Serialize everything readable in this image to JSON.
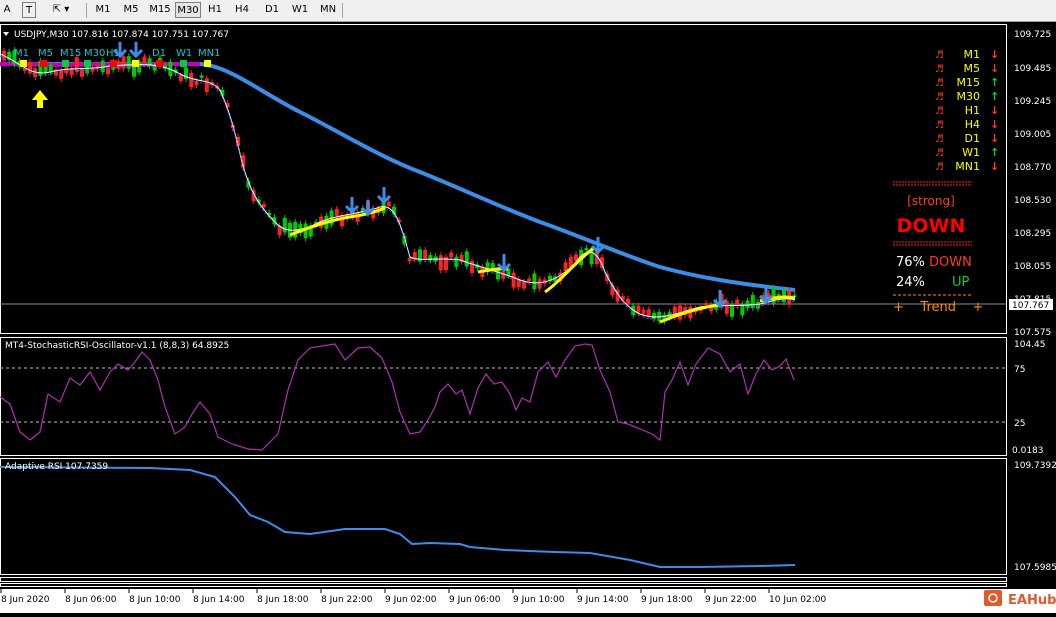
{
  "toolbar": {
    "tools": [
      "A",
      "T"
    ],
    "timeframes": [
      "M1",
      "M5",
      "M15",
      "M30",
      "H1",
      "H4",
      "D1",
      "W1",
      "MN"
    ],
    "active_timeframe": "M30"
  },
  "main_chart": {
    "header": "USDJPY,M30  107.816 107.874 107.751 107.767",
    "tf_strip": [
      "M1",
      "M5",
      "M15",
      "M30",
      "H1",
      "D1",
      "W1",
      "MN1"
    ],
    "price_axis": [
      "109.725",
      "109.485",
      "109.245",
      "109.005",
      "108.770",
      "108.530",
      "108.295",
      "108.055",
      "107.815",
      "107.575"
    ],
    "current_price": "107.767"
  },
  "signal_panel": {
    "rows": [
      {
        "tf": "M1",
        "dir": "down"
      },
      {
        "tf": "M5",
        "dir": "down"
      },
      {
        "tf": "M15",
        "dir": "up"
      },
      {
        "tf": "M30",
        "dir": "up"
      },
      {
        "tf": "H1",
        "dir": "down"
      },
      {
        "tf": "H4",
        "dir": "down"
      },
      {
        "tf": "D1",
        "dir": "down"
      },
      {
        "tf": "W1",
        "dir": "up"
      },
      {
        "tf": "MN1",
        "dir": "down"
      }
    ],
    "strength": "[strong]",
    "verdict": "DOWN",
    "down_pct": "76%",
    "down_label": "DOWN",
    "up_pct": "24%",
    "up_label": "UP",
    "trend_label": "+    Trend    +",
    "colors": {
      "up": "#00cc44",
      "down": "#ff3b1f",
      "label": "#ffff00",
      "verdict": "#ff0000",
      "trend": "#ff8a00"
    }
  },
  "stoch_panel": {
    "title": "MT4-StochasticRSI-Oscillator-v1.1 (8,8,3) 64.8925",
    "axis": [
      "104.45",
      "75",
      "25",
      "0.0183"
    ]
  },
  "rsi_panel": {
    "title": "Adaptive RSI 107.7359",
    "axis": [
      "109.7392",
      "107.5985"
    ]
  },
  "time_axis": [
    "8 Jun 2020",
    "8 Jun 06:00",
    "8 Jun 10:00",
    "8 Jun 14:00",
    "8 Jun 18:00",
    "8 Jun 22:00",
    "9 Jun 02:00",
    "9 Jun 06:00",
    "9 Jun 10:00",
    "9 Jun 14:00",
    "9 Jun 18:00",
    "9 Jun 22:00",
    "10 Jun 02:00"
  ],
  "watermark": "EAHub"
}
